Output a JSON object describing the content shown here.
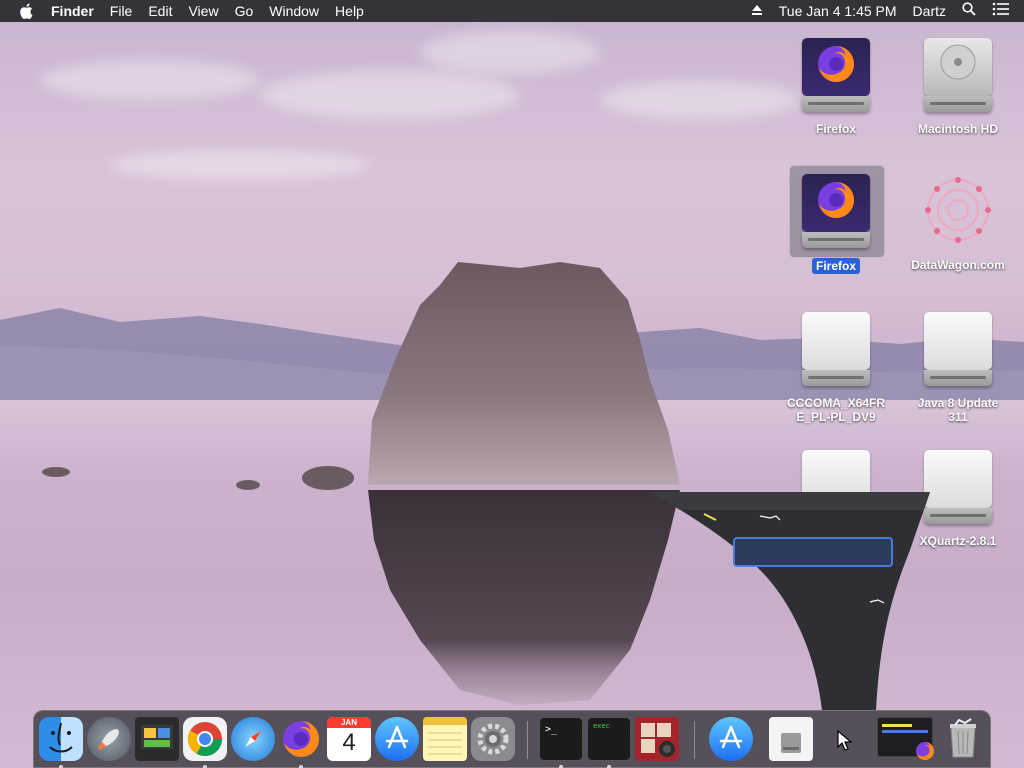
{
  "menubar": {
    "app_name": "Finder",
    "menus": [
      "File",
      "Edit",
      "View",
      "Go",
      "Window",
      "Help"
    ],
    "date_time": "Tue Jan 4  1:45 PM",
    "user": "Dartz",
    "icons": [
      "apple-icon",
      "eject-icon",
      "search-icon",
      "list-icon"
    ]
  },
  "desktop_icons": [
    {
      "label": "Firefox",
      "kind": "firefox-disk",
      "selected": false
    },
    {
      "label": "Macintosh HD",
      "kind": "hard-drive",
      "selected": false
    },
    {
      "label": "Firefox",
      "kind": "firefox-disk",
      "selected": true
    },
    {
      "label": "DataWagon.com",
      "kind": "ornament",
      "selected": false
    },
    {
      "label": "CCCOMA_X64FR\nE_PL-PL_DV9",
      "kind": "external-drive",
      "selected": false
    },
    {
      "label": "Java 8 Update\n311",
      "kind": "external-drive",
      "selected": false
    },
    {
      "label": "",
      "kind": "external-drive",
      "selected": false
    },
    {
      "label": "XQuartz-2.8.1",
      "kind": "external-drive",
      "selected": false
    }
  ],
  "dock": {
    "items": [
      {
        "name": "Finder",
        "running": true
      },
      {
        "name": "Launchpad",
        "running": false
      },
      {
        "name": "Image Capture",
        "running": false
      },
      {
        "name": "Google Chrome",
        "running": true
      },
      {
        "name": "Safari",
        "running": false
      },
      {
        "name": "Firefox",
        "running": true
      },
      {
        "name": "Calendar",
        "running": false,
        "month": "JAN",
        "day": "4"
      },
      {
        "name": "App Store",
        "running": false
      },
      {
        "name": "Notes",
        "running": false
      },
      {
        "name": "System Preferences",
        "running": false
      },
      {
        "name": "Terminal",
        "running": true,
        "glyph": ">_"
      },
      {
        "name": "Exec",
        "running": true,
        "glyph": "exec"
      },
      {
        "name": "Photo Booth",
        "running": false
      },
      {
        "name": "App Store Installer",
        "running": false
      },
      {
        "name": "Disk Utility",
        "running": false
      },
      {
        "name": "Cursor",
        "running": false
      },
      {
        "name": "Firefox Window",
        "running": false
      },
      {
        "name": "Trash",
        "running": false
      }
    ]
  },
  "colors": {
    "menubar": "#28282c",
    "selection": "#2a62d3",
    "firefox_orange": "#ff7a1a",
    "firefox_purple": "#6b2fd6"
  }
}
